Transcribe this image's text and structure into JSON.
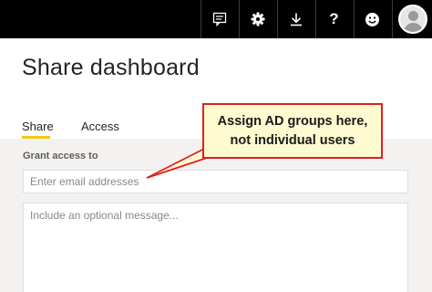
{
  "topbar": {
    "icons": [
      "feedback-icon",
      "settings-gear-icon",
      "download-icon",
      "help-question-icon",
      "smiley-feedback-icon",
      "user-avatar"
    ],
    "help_glyph": "?"
  },
  "page": {
    "title": "Share dashboard"
  },
  "tabs": [
    {
      "label": "Share",
      "active": true
    },
    {
      "label": "Access",
      "active": false
    }
  ],
  "form": {
    "grant_label": "Grant access to",
    "email_placeholder": "Enter email addresses",
    "message_placeholder": "Include an optional message..."
  },
  "callout": {
    "line1": "Assign AD groups here,",
    "line2": "not individual users"
  },
  "colors": {
    "topbar": "#000000",
    "accent_underline": "#f2c811",
    "callout_border": "#e02020",
    "callout_fill": "#fefbd0",
    "form_background": "#f3f2f1"
  }
}
